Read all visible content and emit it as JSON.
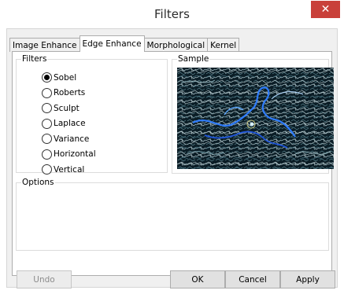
{
  "window": {
    "title": "Filters"
  },
  "tabs": [
    {
      "label": "Image Enhance",
      "active": false
    },
    {
      "label": "Edge Enhance",
      "active": true
    },
    {
      "label": "Morphological",
      "active": false
    },
    {
      "label": "Kernel",
      "active": false
    }
  ],
  "filters_group": {
    "label": "Filters",
    "options": [
      {
        "label": "Sobel",
        "selected": true
      },
      {
        "label": "Roberts",
        "selected": false
      },
      {
        "label": "Sculpt",
        "selected": false
      },
      {
        "label": "Laplace",
        "selected": false
      },
      {
        "label": "Variance",
        "selected": false
      },
      {
        "label": "Horizontal",
        "selected": false
      },
      {
        "label": "Vertical",
        "selected": false
      }
    ]
  },
  "sample_group": {
    "label": "Sample"
  },
  "options_group": {
    "label": "Options"
  },
  "buttons": {
    "undo": "Undo",
    "ok": "OK",
    "cancel": "Cancel",
    "apply": "Apply"
  },
  "colors": {
    "close_button": "#c9403a",
    "window_bg": "#f0f0f0",
    "edge_highlight": "#3a7bff"
  }
}
